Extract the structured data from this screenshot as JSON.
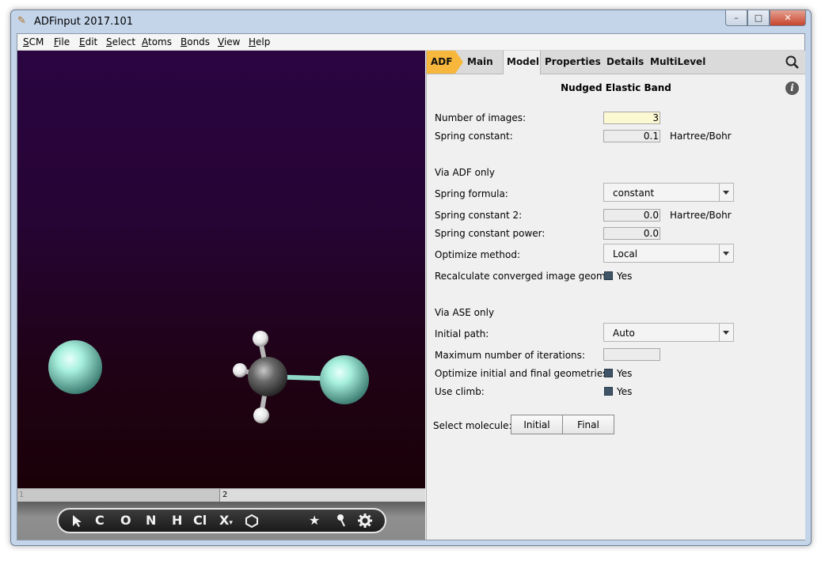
{
  "window": {
    "title": "ADFinput 2017.101",
    "minimize": "–",
    "maximize": "□",
    "close": "✕"
  },
  "menu": [
    {
      "label": "SCM",
      "u": "S",
      "rest": "CM"
    },
    {
      "label": "File",
      "u": "F",
      "rest": "ile"
    },
    {
      "label": "Edit",
      "u": "E",
      "rest": "dit"
    },
    {
      "label": "Select",
      "u": "S",
      "rest": "elect"
    },
    {
      "label": "Atoms",
      "u": "A",
      "rest": "toms"
    },
    {
      "label": "Bonds",
      "u": "B",
      "rest": "onds"
    },
    {
      "label": "View",
      "u": "V",
      "rest": "iew"
    },
    {
      "label": "Help",
      "u": "H",
      "rest": "elp"
    }
  ],
  "viewport": {
    "slider": [
      "1",
      "2"
    ],
    "tools": [
      "C",
      "O",
      "N",
      "H",
      "Cl",
      "X",
      "★"
    ]
  },
  "tabs": [
    "ADF",
    "Main",
    "Model",
    "Properties",
    "Details",
    "MultiLevel"
  ],
  "panel": {
    "title": "Nudged Elastic Band",
    "num_images_label": "Number of images:",
    "num_images_value": "3",
    "spring_constant_label": "Spring constant:",
    "spring_constant_value": "0.1",
    "unit": "Hartree/Bohr",
    "via_adf": "Via ADF only",
    "spring_formula_label": "Spring formula:",
    "spring_formula_value": "constant",
    "spring_constant2_label": "Spring constant 2:",
    "spring_constant2_value": "0.0",
    "spring_constant_power_label": "Spring constant power:",
    "spring_constant_power_value": "0.0",
    "optimize_method_label": "Optimize method:",
    "optimize_method_value": "Local",
    "recalc_label": "Recalculate converged image geome",
    "yes": "Yes",
    "via_ase": "Via ASE only",
    "initial_path_label": "Initial path:",
    "initial_path_value": "Auto",
    "max_iter_label": "Maximum number of iterations:",
    "max_iter_value": "",
    "optimize_initial_label": "Optimize initial and final geometries:",
    "use_climb_label": "Use climb:",
    "select_molecule_label": "Select molecule:",
    "initial_button": "Initial",
    "final_button": "Final"
  },
  "colors": {
    "adf_tab": "#f6b73c",
    "fluorine": "#9ee8d8",
    "carbon": "#555555",
    "hydrogen": "#ffffff"
  }
}
